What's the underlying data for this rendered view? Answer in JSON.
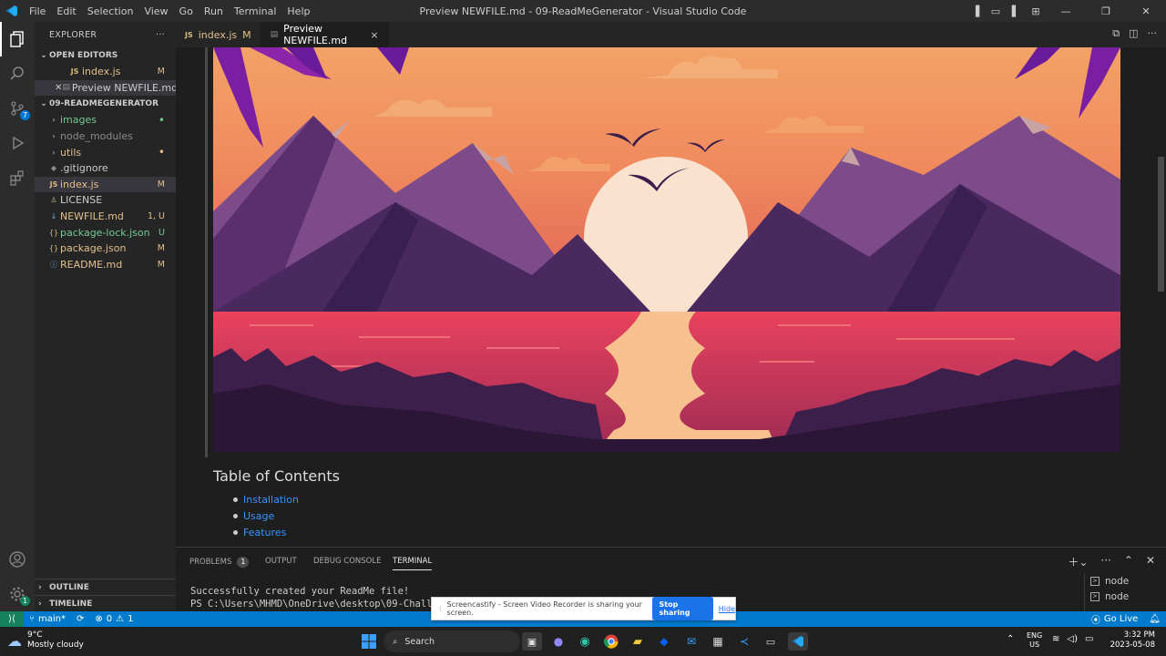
{
  "titlebar": {
    "menu": [
      "File",
      "Edit",
      "Selection",
      "View",
      "Go",
      "Run",
      "Terminal",
      "Help"
    ],
    "title": "Preview NEWFILE.md - 09-ReadMeGenerator - Visual Studio Code"
  },
  "activity": {
    "scm_badge": "7",
    "settings_badge": "1"
  },
  "sidebar": {
    "header": "EXPLORER",
    "open_editors_label": "OPEN EDITORS",
    "open_editors": [
      {
        "icon": "JS",
        "name": "index.js",
        "status": "M"
      },
      {
        "icon": "preview",
        "name": "Preview NEWFILE.md",
        "status": ""
      }
    ],
    "project_label": "09-READMEGENERATOR",
    "files": [
      {
        "name": "images",
        "status": "•",
        "type": "folder"
      },
      {
        "name": "node_modules",
        "status": "",
        "type": "folder"
      },
      {
        "name": "utils",
        "status": "•",
        "type": "folder"
      },
      {
        "name": ".gitignore",
        "status": "",
        "type": "file"
      },
      {
        "name": "index.js",
        "status": "M",
        "type": "file"
      },
      {
        "name": "LICENSE",
        "status": "",
        "type": "file"
      },
      {
        "name": "NEWFILE.md",
        "status": "1, U",
        "type": "file"
      },
      {
        "name": "package-lock.json",
        "status": "U",
        "type": "file"
      },
      {
        "name": "package.json",
        "status": "M",
        "type": "file"
      },
      {
        "name": "README.md",
        "status": "M",
        "type": "file"
      }
    ],
    "outline_label": "OUTLINE",
    "timeline_label": "TIMELINE"
  },
  "tabs": [
    {
      "name": "index.js",
      "status": "M"
    },
    {
      "name": "Preview NEWFILE.md",
      "close": "×"
    }
  ],
  "preview": {
    "toc_title": "Table of Contents",
    "toc_items": [
      "Installation",
      "Usage",
      "Features"
    ]
  },
  "panel": {
    "tabs": [
      "PROBLEMS",
      "OUTPUT",
      "DEBUG CONSOLE",
      "TERMINAL"
    ],
    "problems_count": "1",
    "terminal_lines": [
      "Successfully created your ReadMe file!",
      "PS C:\\Users\\MHMD\\OneDrive\\desktop\\09-Challen"
    ],
    "terminals": [
      "node",
      "node"
    ]
  },
  "banner": {
    "text": "Screencastify - Screen Video Recorder is sharing your screen.",
    "stop": "Stop sharing",
    "hide": "Hide"
  },
  "statusbar": {
    "branch": "main*",
    "errors": "0",
    "warnings": "1",
    "golive": "Go Live"
  },
  "taskbar": {
    "weather_temp": "9°C",
    "weather_desc": "Mostly cloudy",
    "search": "Search",
    "lang1": "ENG",
    "lang2": "US",
    "time": "3:32 PM",
    "date": "2023-05-08"
  },
  "colors": {
    "accent": "#007acc",
    "link": "#3794ff",
    "modified": "#e2c08d",
    "untracked": "#73c991"
  }
}
